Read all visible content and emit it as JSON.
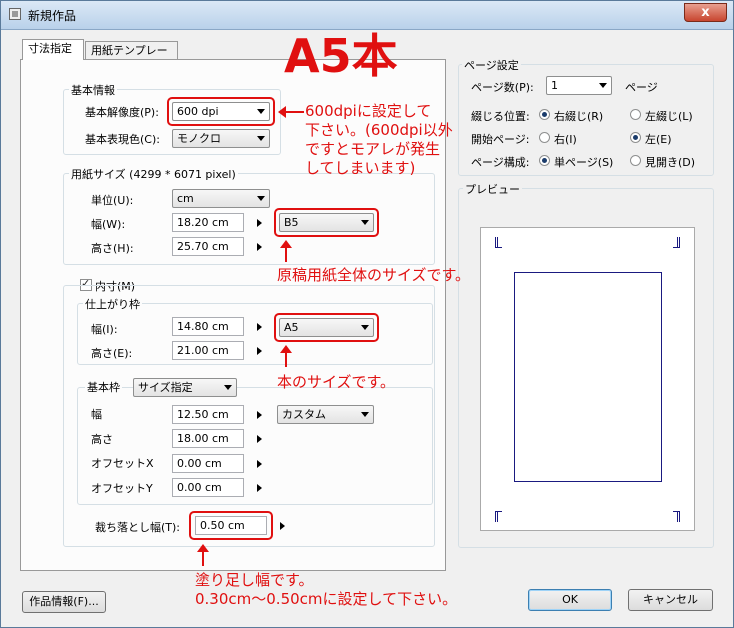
{
  "window": {
    "title": "新規作品",
    "close_label": "x"
  },
  "tabs": {
    "size": "寸法指定",
    "template": "用紙テンプレート"
  },
  "basic": {
    "group_label": "基本情報",
    "resolution_label": "基本解像度(P):",
    "resolution_value": "600 dpi",
    "color_label": "基本表現色(C):",
    "color_value": "モノクロ"
  },
  "paper": {
    "group_label": "用紙サイズ (4299 * 6071 pixel)",
    "unit_label": "単位(U):",
    "unit_value": "cm",
    "width_label": "幅(W):",
    "width_value": "18.20 cm",
    "height_label": "高さ(H):",
    "height_value": "25.70 cm",
    "preset_value": "B5"
  },
  "inner": {
    "checkbox_label": "内寸(M)",
    "finish_group_label": "仕上がり枠",
    "finish_width_label": "幅(I):",
    "finish_width_value": "14.80 cm",
    "finish_height_label": "高さ(E):",
    "finish_height_value": "21.00 cm",
    "finish_preset_value": "A5",
    "frame_label": "基本枠",
    "frame_mode_value": "サイズ指定",
    "frame_width_label": "幅",
    "frame_width_value": "12.50 cm",
    "frame_height_label": "高さ",
    "frame_height_value": "18.00 cm",
    "frame_preset_value": "カスタム",
    "offset_x_label": "オフセットX",
    "offset_x_value": "0.00 cm",
    "offset_y_label": "オフセットY",
    "offset_y_value": "0.00 cm"
  },
  "bleed": {
    "label": "裁ち落とし幅(T):",
    "value": "0.50 cm"
  },
  "page_settings": {
    "group_label": "ページ設定",
    "pages_label": "ページ数(P):",
    "pages_value": "1",
    "pages_suffix": "ページ",
    "binding_label": "綴じる位置:",
    "binding_right": "右綴じ(R)",
    "binding_left": "左綴じ(L)",
    "start_label": "開始ページ:",
    "start_right": "右(I)",
    "start_left": "左(E)",
    "layout_label": "ページ構成:",
    "layout_single": "単ページ(S)",
    "layout_spread": "見開き(D)"
  },
  "preview_label": "プレビュー",
  "buttons": {
    "info": "作品情報(F)...",
    "ok": "OK",
    "cancel": "キャンセル"
  },
  "annotations": {
    "big_title": "A5本",
    "dpi_note": [
      "600dpiに設定して",
      "下さい。(600dpi以外",
      "ですとモアレが発生",
      "してしまいます)"
    ],
    "paper_note": "原稿用紙全体のサイズです。",
    "book_note": "本のサイズです。",
    "bleed_note": [
      "塗り足し幅です。",
      "0.30cm〜0.50cmに設定して下さい。"
    ]
  },
  "colors": {
    "annotation_red": "#e01010",
    "preview_frame": "#1a1a80"
  }
}
